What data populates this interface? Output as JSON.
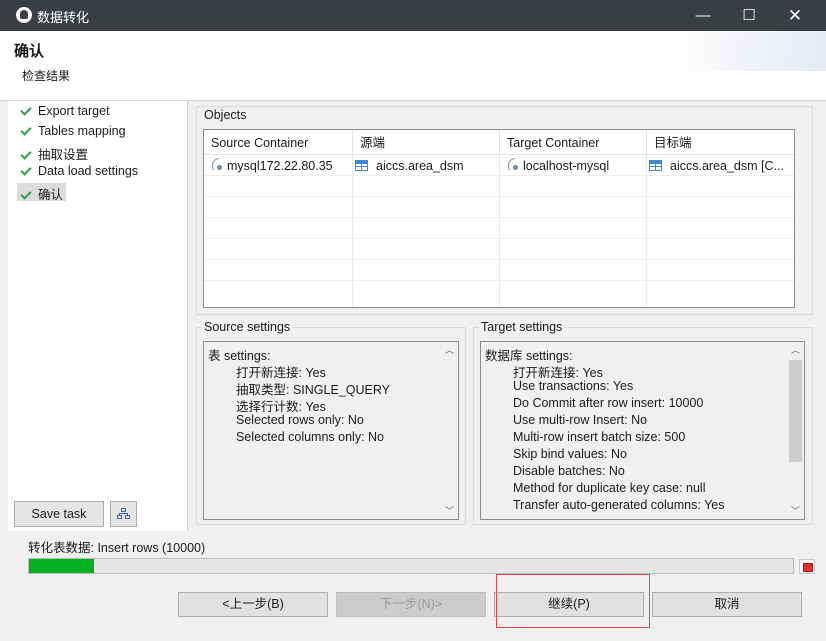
{
  "window": {
    "title": "数据转化",
    "minimize": "—",
    "maximize": "☐",
    "close": "✕"
  },
  "header": {
    "title": "确认",
    "subtitle": "检查结果"
  },
  "steps": [
    {
      "label": "Export target",
      "done": true,
      "active": false
    },
    {
      "label": "Tables mapping",
      "done": true,
      "active": false
    },
    {
      "label": "抽取设置",
      "done": true,
      "active": false
    },
    {
      "label": "Data load settings",
      "done": true,
      "active": false
    },
    {
      "label": "确认",
      "done": true,
      "active": true
    }
  ],
  "left_buttons": {
    "save_task": "Save task",
    "icon": "tree-structure-icon"
  },
  "objects": {
    "label": "Objects",
    "columns": [
      "Source Container",
      "源端",
      "Target Container",
      "目标端"
    ],
    "rows": [
      {
        "source_container": "mysql172.22.80.35",
        "source": "aiccs.area_dsm",
        "target_container": "localhost-mysql",
        "target": "aiccs.area_dsm [C..."
      }
    ]
  },
  "source_settings": {
    "label": "Source settings",
    "lines": [
      {
        "text": "表 settings:",
        "indent": false
      },
      {
        "text": "打开新连接: Yes",
        "indent": true
      },
      {
        "text": "抽取类型: SINGLE_QUERY",
        "indent": true
      },
      {
        "text": "选择行计数: Yes",
        "indent": true
      },
      {
        "text": "Selected rows only: No",
        "indent": true
      },
      {
        "text": "Selected columns only: No",
        "indent": true
      }
    ]
  },
  "target_settings": {
    "label": "Target settings",
    "lines": [
      {
        "text": "数据库 settings:",
        "indent": false
      },
      {
        "text": "打开新连接: Yes",
        "indent": true
      },
      {
        "text": "Use transactions: Yes",
        "indent": true
      },
      {
        "text": "Do Commit after row insert: 10000",
        "indent": true
      },
      {
        "text": "Use multi-row Insert: No",
        "indent": true
      },
      {
        "text": "Multi-row insert batch size: 500",
        "indent": true
      },
      {
        "text": "Skip bind values: No",
        "indent": true
      },
      {
        "text": "Disable batches: No",
        "indent": true
      },
      {
        "text": "Method for duplicate key case: null",
        "indent": true
      },
      {
        "text": "Transfer auto-generated columns: Yes",
        "indent": true
      }
    ]
  },
  "status": {
    "text": "转化表数据:  Insert rows (10000)",
    "progress": 0.085
  },
  "footer": {
    "back": "<上一步(B)",
    "next": "下一步(N)>",
    "continue": "继续(P)",
    "cancel": "取消"
  },
  "colors": {
    "progress": "#06b025",
    "check": "#2e9e3e",
    "highlight": "#e04848"
  }
}
